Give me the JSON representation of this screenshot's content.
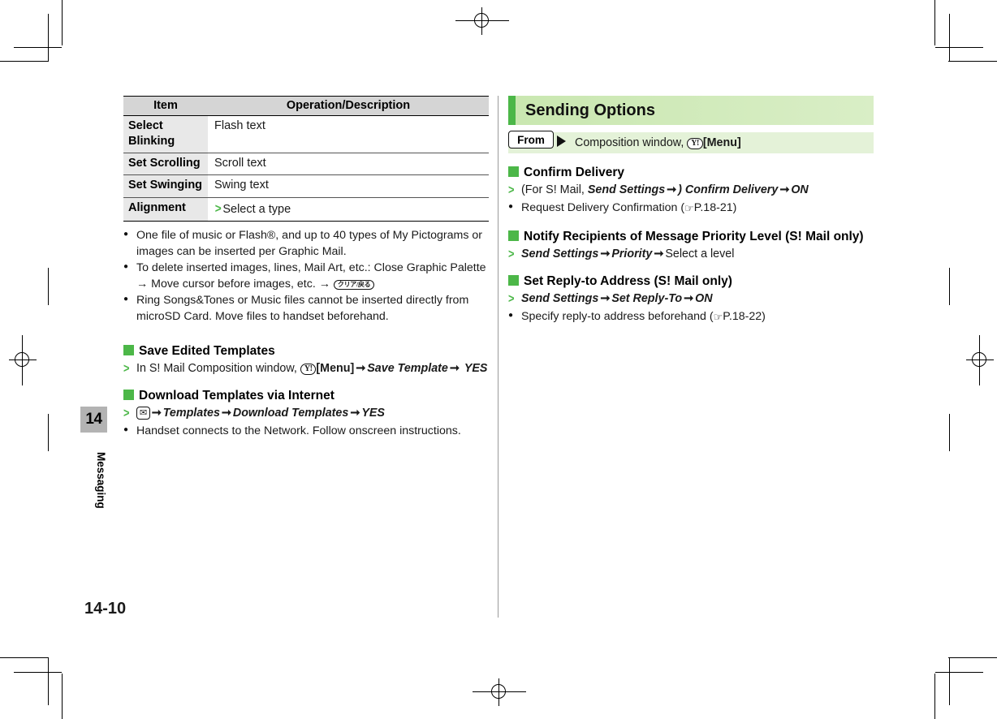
{
  "page": {
    "folio": "14-10",
    "chapter_number": "14",
    "chapter_label": "Messaging"
  },
  "left_column": {
    "table": {
      "headers": [
        "Item",
        "Operation/Description"
      ],
      "rows": [
        {
          "item": "Select Blinking",
          "desc": "Flash text",
          "has_arrow": false
        },
        {
          "item": "Set Scrolling",
          "desc": "Scroll text",
          "has_arrow": false
        },
        {
          "item": "Set Swinging",
          "desc": "Swing text",
          "has_arrow": false
        },
        {
          "item": "Alignment",
          "desc": "Select a type",
          "has_arrow": true
        }
      ]
    },
    "notes": [
      "One file of music or Flash®, and up to 40 types of My Pictograms or images can be inserted per Graphic Mail.",
      "To delete inserted images, lines, Mail Art, etc.: Close Graphic Palette → Move cursor before images, etc. →",
      "Ring Songs&Tones or Music files cannot be inserted directly from microSD Card. Move files to handset beforehand."
    ],
    "sections": [
      {
        "heading": "Save Edited Templates",
        "step_prefix": "In S! Mail Composition window,",
        "key": "Y!",
        "key_label": "[Menu]",
        "arrow1": "➞",
        "step_item1": "Save Template",
        "arrow2": "➞",
        "step_item2": "YES"
      },
      {
        "heading": "Download Templates via Internet",
        "key_icon": "mail-icon",
        "arrow1": "➞",
        "step_item1": "Templates",
        "arrow2": "➞",
        "step_item2": "Download Templates",
        "arrow3": "➞",
        "step_item3": "YES",
        "note": "Handset connects to the Network. Follow onscreen instructions."
      }
    ]
  },
  "right_column": {
    "section_title": "Sending Options",
    "from_label": "From",
    "from_text": "Composition window,",
    "from_key": "Y!",
    "from_key_label": "[Menu]",
    "blocks": [
      {
        "heading": "Confirm Delivery",
        "step": {
          "pre": "(For S! Mail,",
          "em1": "Send Settings",
          "arrow1": "➞",
          "mid": ")",
          "em2": "Confirm Delivery",
          "arrow2": "➞",
          "em3": "ON"
        },
        "note_pre": "Request Delivery Confirmation (",
        "note_ref": "P.18-21",
        "note_post": ")"
      },
      {
        "heading": "Notify Recipients of Message Priority Level (S! Mail only)",
        "step": {
          "em1": "Send Settings",
          "arrow1": "➞",
          "em2": "Priority",
          "arrow2": "➞",
          "tail": "Select a level"
        }
      },
      {
        "heading": "Set Reply-to Address (S! Mail only)",
        "step": {
          "em1": "Send Settings",
          "arrow1": "➞",
          "em2": "Set Reply-To",
          "arrow2": "➞",
          "em3": "ON"
        },
        "note_pre": "Specify reply-to address beforehand (",
        "note_ref": "P.18-22",
        "note_post": ")"
      }
    ]
  },
  "colors": {
    "green_accent": "#4cb748",
    "banner_light": "#c9e7b0",
    "table_header_gray": "#d5d5d5",
    "table_item_gray": "#e8e8e8",
    "tab_gray": "#b3b3b3"
  }
}
